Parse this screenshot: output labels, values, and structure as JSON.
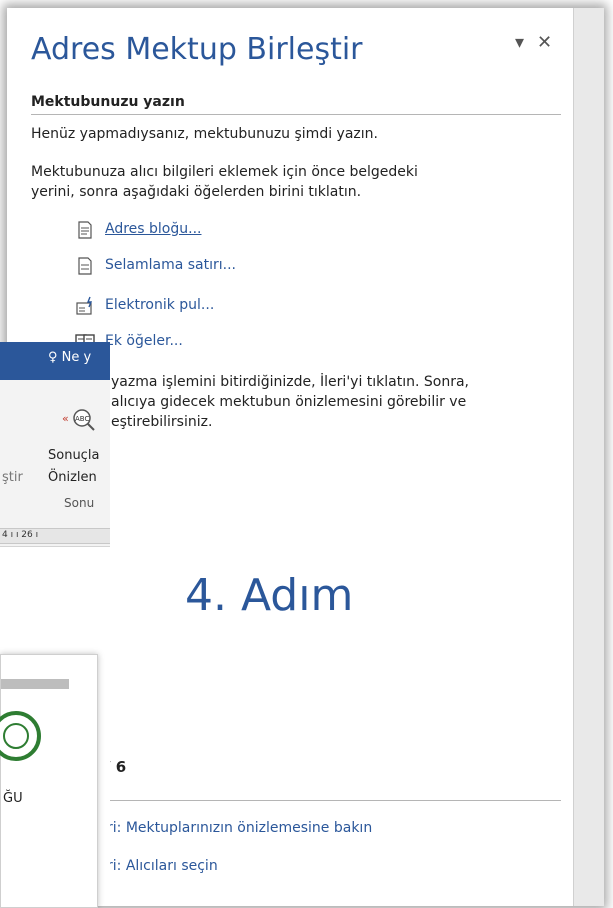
{
  "pane": {
    "title": "Adres Mektup Birleştir",
    "section_heading": "Mektubunuzu yazın",
    "intro_line": "Henüz yapmadıysanız, mektubunuzu şimdi yazın.",
    "desc_line1": "Mektubunuza alıcı bilgileri eklemek için önce belgedeki",
    "desc_line2": "yerini, sonra aşağıdaki öğelerden birini tıklatın.",
    "items": [
      {
        "label": "Adres bloğu...",
        "icon": "address-block-icon"
      },
      {
        "label": "Selamlama satırı...",
        "icon": "greeting-line-icon"
      },
      {
        "label": "Elektronik pul...",
        "icon": "electronic-postage-icon"
      },
      {
        "label": "Ek öğeler...",
        "icon": "more-items-icon"
      }
    ],
    "finish_line1": "yazma işlemini bitirdiğinizde, İleri'yi tıklatın. Sonra,",
    "finish_line2": "alıcıya gidecek mektubun önizlemesini görebilir ve",
    "finish_line3": "eştirebilirsiniz.",
    "big_step": "4. Adım",
    "step_count": "/ 6",
    "next_link": "ri: Mektuplarınızın önizlemesine bakın",
    "prev_link": "ri: Alıcıları seçin",
    "controls": {
      "dropdown": "▾",
      "close": "✕"
    }
  },
  "background_window": {
    "search_text": "Ne y",
    "ribbon_text1": "Sonuçla",
    "ribbon_text2": "Önizlen",
    "ribbon_group": "Sonu",
    "ribbon_left": "ştir",
    "ruler_text": "4 ı ı 26 ı",
    "doc_text": "ĞU"
  },
  "colors": {
    "accent": "#2b579a",
    "title_bar": "#2b579a",
    "seal": "#2e7d32"
  }
}
